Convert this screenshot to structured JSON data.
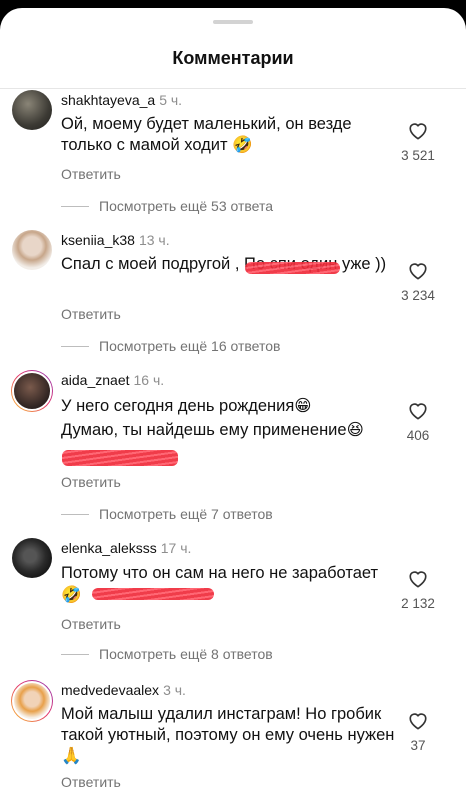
{
  "header": {
    "title": "Комментарии"
  },
  "comments": [
    {
      "username": "shakhtayeva_a",
      "time": "5 ч.",
      "text": "Ой, моему будет маленький, он везде только с мамой ходит 🤣",
      "likes": "3 521",
      "reply": "Ответить",
      "more": "Посмотреть ещё 53 ответа"
    },
    {
      "username": "kseniia_k38",
      "time": "13 ч.",
      "text": "Спал с моей подругой ,              По спи один уже ))",
      "likes": "3 234",
      "reply": "Ответить",
      "more": "Посмотреть ещё 16 ответов"
    },
    {
      "username": "aida_znaet",
      "time": "16 ч.",
      "text_line1": "У него сегодня день рождения😁",
      "text_line2": "Думаю, ты найдешь ему применение😆",
      "likes": "406",
      "reply": "Ответить",
      "more": "Посмотреть ещё 7 ответов"
    },
    {
      "username": "elenka_aleksss",
      "time": "17 ч.",
      "text_line1": "Потому что он сам на него не заработает",
      "text_line2": "🤣",
      "likes": "2 132",
      "reply": "Ответить",
      "more": "Посмотреть ещё 8 ответов"
    },
    {
      "username": "medvedevaalex",
      "time": "3 ч.",
      "text": "Мой малыш удалил инстаграм! Но гробик такой уютный, поэтому он ему очень нужен 🙏",
      "likes": "37",
      "reply": "Ответить"
    }
  ]
}
